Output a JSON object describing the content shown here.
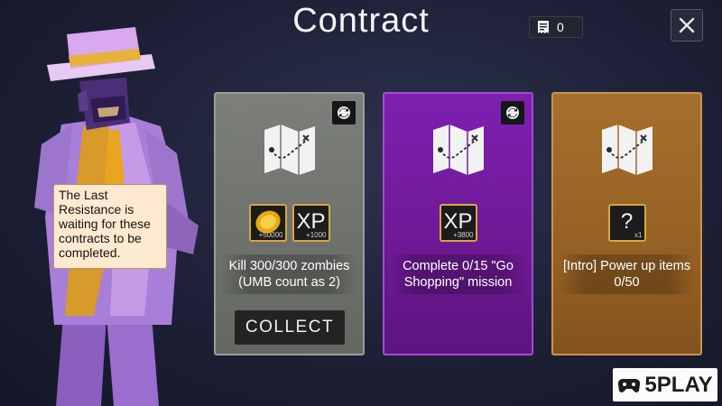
{
  "header": {
    "title": "Contract"
  },
  "tickets": {
    "count": "0"
  },
  "character": {
    "speech": "The Last Resistance is waiting for these contracts to be completed."
  },
  "cards": [
    {
      "theme": "gray",
      "rewards": [
        {
          "type": "coin",
          "amount": "+50000"
        },
        {
          "type": "xp",
          "label": "XP",
          "amount": "+1000"
        }
      ],
      "description": "Kill 300/300 zombies (UMB count as 2)",
      "action": "COLLECT"
    },
    {
      "theme": "purple",
      "rewards": [
        {
          "type": "xp",
          "label": "XP",
          "amount": "+3800"
        }
      ],
      "description": "Complete 0/15 \"Go Shopping\" mission"
    },
    {
      "theme": "orange",
      "rewards": [
        {
          "type": "mystery",
          "label": "?",
          "amount": "x1"
        }
      ],
      "description": "[Intro] Power up items 0/50"
    }
  ],
  "watermark": {
    "text": "5PLAY"
  },
  "colors": {
    "card_gray": "#74776f",
    "card_purple": "#761caa",
    "card_orange": "#9b6727",
    "reward_border": "#d9a640"
  }
}
